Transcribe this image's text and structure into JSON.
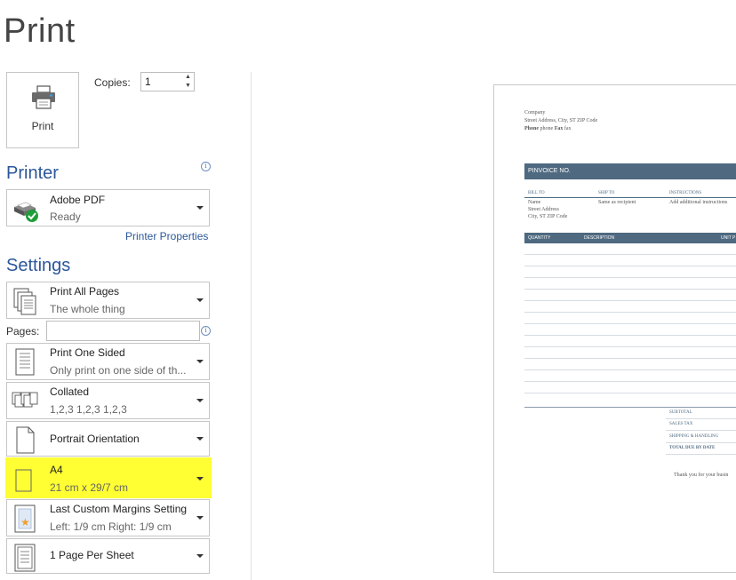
{
  "title": "Print",
  "print_button": {
    "label": "Print",
    "icon": "printer-icon"
  },
  "copies": {
    "label": "Copies:",
    "value": "1"
  },
  "printer": {
    "heading": "Printer",
    "name": "Adobe PDF",
    "status": "Ready",
    "properties_link": "Printer Properties"
  },
  "settings": {
    "heading": "Settings",
    "pages_label": "Pages:",
    "pages_value": "",
    "items": [
      {
        "line1": "Print All Pages",
        "line2": "The whole thing"
      },
      {
        "line1": "Print One Sided",
        "line2": "Only print on one side of th..."
      },
      {
        "line1": "Collated",
        "line2": "1,2,3    1,2,3    1,2,3"
      },
      {
        "line1": "Portrait Orientation",
        "line2": ""
      },
      {
        "line1": "A4",
        "line2": "21 cm x 29/7 cm"
      },
      {
        "line1": "Last Custom Margins Setting",
        "line2": "Left:  1/9 cm    Right:  1/9 cm"
      },
      {
        "line1": "1 Page Per Sheet",
        "line2": ""
      }
    ]
  },
  "highlight_color": "#ffff33",
  "accent_color": "#2b579a",
  "invoice": {
    "company": "Company",
    "address": "Street Address, City, ST ZIP Code",
    "phone_label": "Phone",
    "phone": "phone",
    "fax_label": "Fax",
    "fax": "fax",
    "heading": "PINVOICE NO.",
    "bill_to": "BILL TO",
    "ship_to": "SHIP TO",
    "instructions": "INSTRUCTIONS",
    "bill_name": "Name",
    "bill_street": "Street Address",
    "bill_city": "City, ST ZIP Code",
    "ship_value": "Same as recipient",
    "instr_value": "Add additional instructions",
    "col_qty": "QUANTITY",
    "col_desc": "DESCRIPTION",
    "col_unit": "UNIT P",
    "subtotal": "SUBTOTAL",
    "sales_tax": "SALES TAX",
    "shipping": "SHIPPING & HANDLING",
    "total": "TOTAL DUE BY DATE",
    "thanks": "Thank you for your busin"
  }
}
